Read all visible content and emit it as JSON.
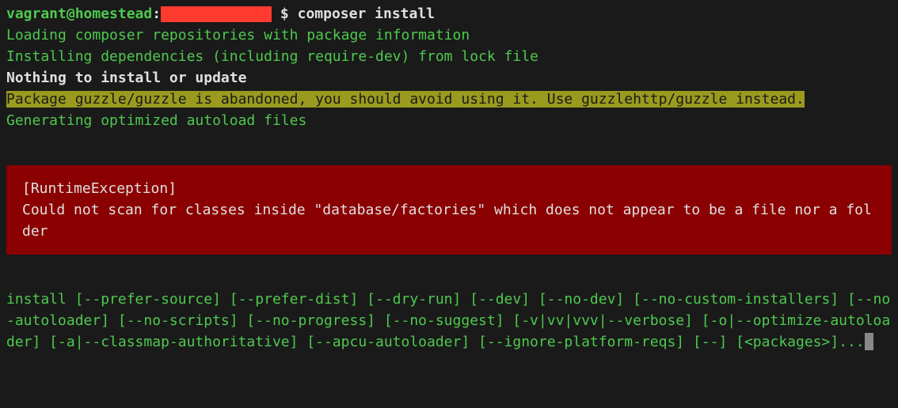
{
  "prompt": {
    "user_host": "vagrant@homestead",
    "separator": ":",
    "dollar": "$",
    "command": "composer install"
  },
  "output": {
    "line1": "Loading composer repositories with package information",
    "line2": "Installing dependencies (including require-dev) from lock file",
    "line3": "Nothing to install or update",
    "warning": "Package guzzle/guzzle is abandoned, you should avoid using it. Use guzzlehttp/guzzle instead.",
    "line5": "Generating optimized autoload files"
  },
  "error": {
    "title": "[RuntimeException]",
    "message": "Could not scan for classes inside \"database/factories\" which does not appear to be a file nor a folder"
  },
  "usage": "install [--prefer-source] [--prefer-dist] [--dry-run] [--dev] [--no-dev] [--no-custom-installers] [--no-autoloader] [--no-scripts] [--no-progress] [--no-suggest] [-v|vv|vvv|--verbose] [-o|--optimize-autoloader] [-a|--classmap-authoritative] [--apcu-autoloader] [--ignore-platform-reqs] [--] [<packages>]..."
}
